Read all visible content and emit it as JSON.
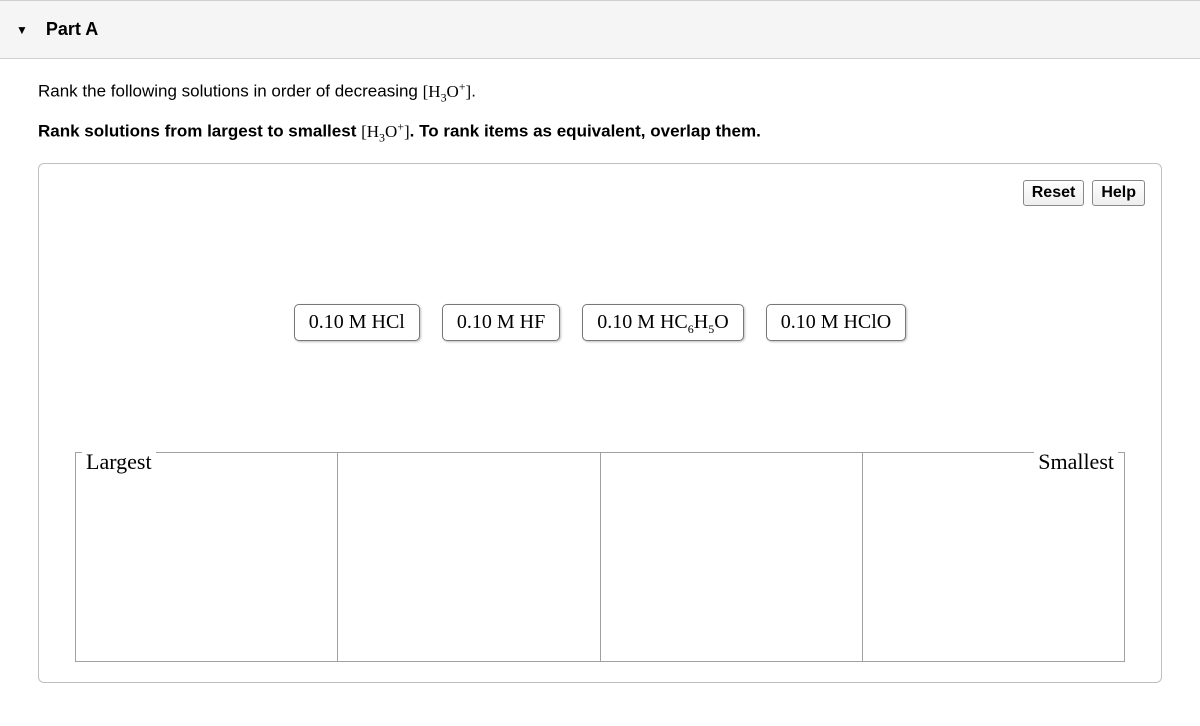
{
  "header": {
    "part_label": "Part A"
  },
  "instructions": {
    "line1_before": "Rank the following solutions in order of decreasing ",
    "line1_formula": "[H3O+]",
    "line1_after": ".",
    "line2_before": "Rank solutions from largest to smallest ",
    "line2_formula": "[H3O+]",
    "line2_after": ". To rank items as equivalent, overlap them."
  },
  "buttons": {
    "reset": "Reset",
    "help": "Help"
  },
  "items": [
    "0.10 M HCl",
    "0.10 M HF",
    "0.10 M HC6H5O",
    "0.10 M HClO"
  ],
  "dropzone": {
    "left_label": "Largest",
    "right_label": "Smallest"
  }
}
